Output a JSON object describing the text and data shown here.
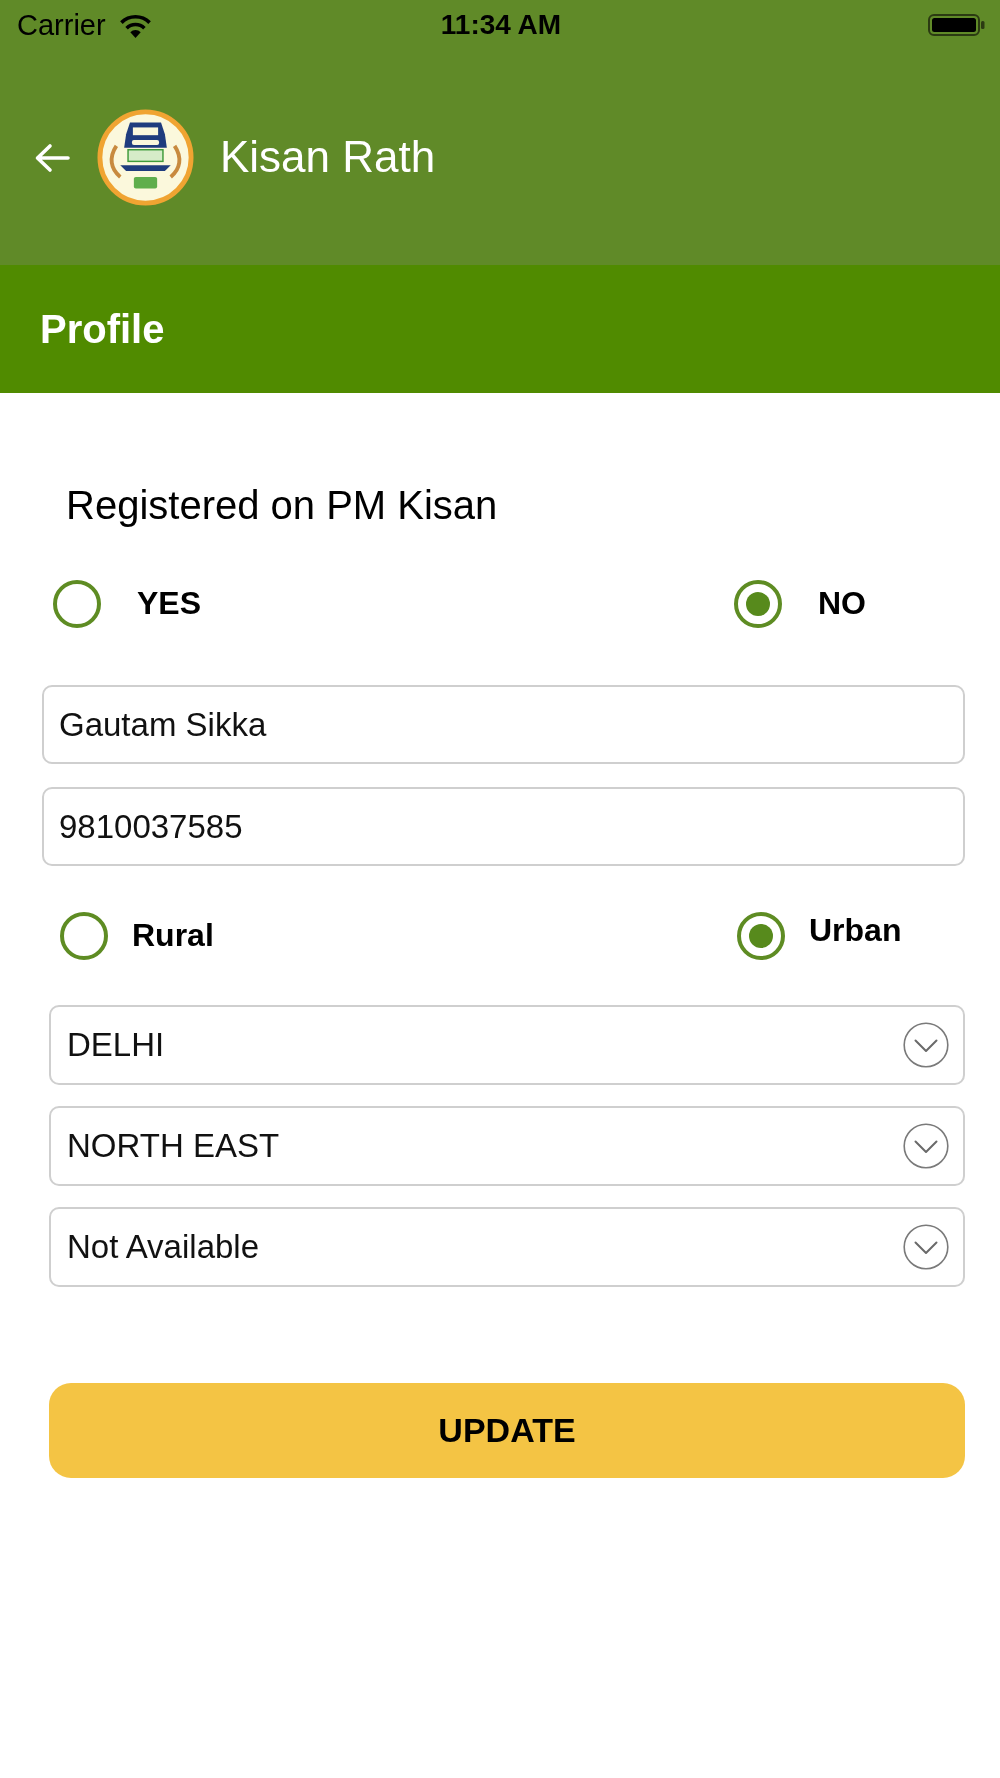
{
  "status_bar": {
    "carrier": "Carrier",
    "time": "11:34 AM"
  },
  "app_bar": {
    "title": "Kisan Rath"
  },
  "page_header": {
    "title": "Profile"
  },
  "form": {
    "question": "Registered on PM Kisan",
    "registered_options": [
      {
        "label": "YES",
        "selected": false
      },
      {
        "label": "NO",
        "selected": true
      }
    ],
    "name": {
      "value": "Gautam Sikka"
    },
    "mobile": {
      "value": "9810037585"
    },
    "area_options": [
      {
        "label": "Rural",
        "selected": false
      },
      {
        "label": "Urban",
        "selected": true
      }
    ],
    "dropdowns": [
      {
        "value": "DELHI"
      },
      {
        "value": "NORTH EAST"
      },
      {
        "value": "Not Available"
      }
    ],
    "submit": {
      "label": "UPDATE"
    }
  }
}
